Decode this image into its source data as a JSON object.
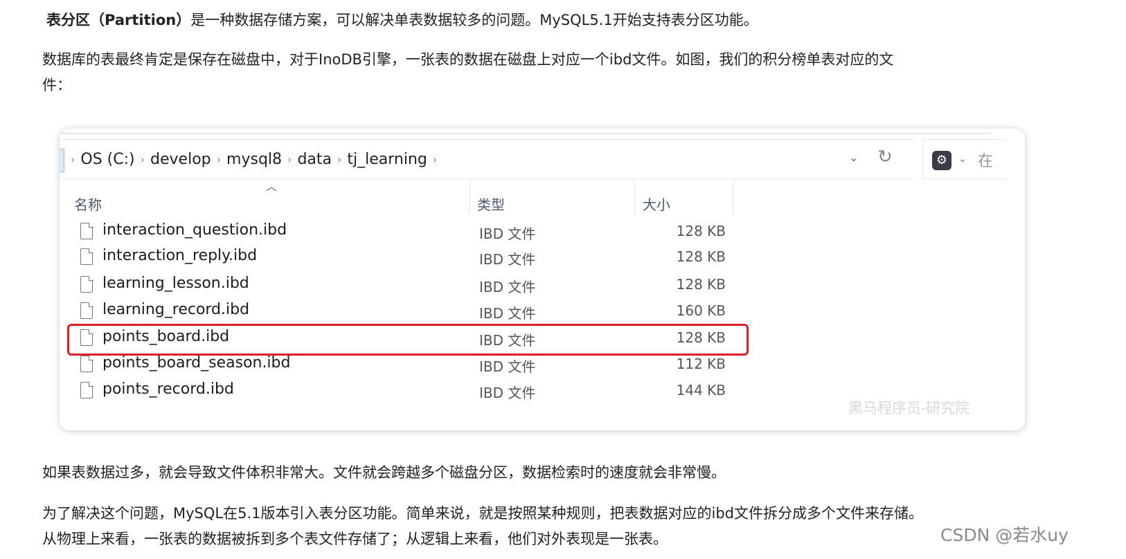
{
  "intro": {
    "term": "表分区（Partition）",
    "text": "是一种数据存储方案，可以解决单表数据较多的问题。MySQL5.1开始支持表分区功能。"
  },
  "para2": {
    "line1": "数据库的表最终肯定是保存在磁盘中，对于InoDB引擎，一张表的数据在磁盘上对应一个ibd文件。如图，我们的积分榜单表对应的文",
    "line2": "件："
  },
  "explorer": {
    "breadcrumb": [
      "OS (C:)",
      "develop",
      "mysql8",
      "data",
      "tj_learning"
    ],
    "search_placeholder": "在",
    "columns": {
      "name": "名称",
      "type": "类型",
      "size": "大小"
    },
    "files": [
      {
        "name": "interaction_question.ibd",
        "type": "IBD 文件",
        "size": "128 KB"
      },
      {
        "name": "interaction_reply.ibd",
        "type": "IBD 文件",
        "size": "128 KB"
      },
      {
        "name": "learning_lesson.ibd",
        "type": "IBD 文件",
        "size": "128 KB"
      },
      {
        "name": "learning_record.ibd",
        "type": "IBD 文件",
        "size": "160 KB"
      },
      {
        "name": "points_board.ibd",
        "type": "IBD 文件",
        "size": "128 KB",
        "highlighted": true
      },
      {
        "name": "points_board_season.ibd",
        "type": "IBD 文件",
        "size": "112 KB"
      },
      {
        "name": "points_record.ibd",
        "type": "IBD 文件",
        "size": "144 KB"
      }
    ],
    "watermark": "黑马程序员-研究院",
    "highlight_color": "#e01c24"
  },
  "para3": "如果表数据过多，就会导致文件体积非常大。文件就会跨越多个磁盘分区，数据检索时的速度就会非常慢。",
  "para4": {
    "line1": "为了解决这个问题，MySQL在5.1版本引入表分区功能。简单来说，就是按照某种规则，把表数据对应的ibd文件拆分成多个文件来存储。",
    "line2": "从物理上来看，一张表的数据被拆到多个表文件存储了；从逻辑上来看，他们对外表现是一张表。"
  },
  "footer_watermark": "CSDN @若水uy"
}
